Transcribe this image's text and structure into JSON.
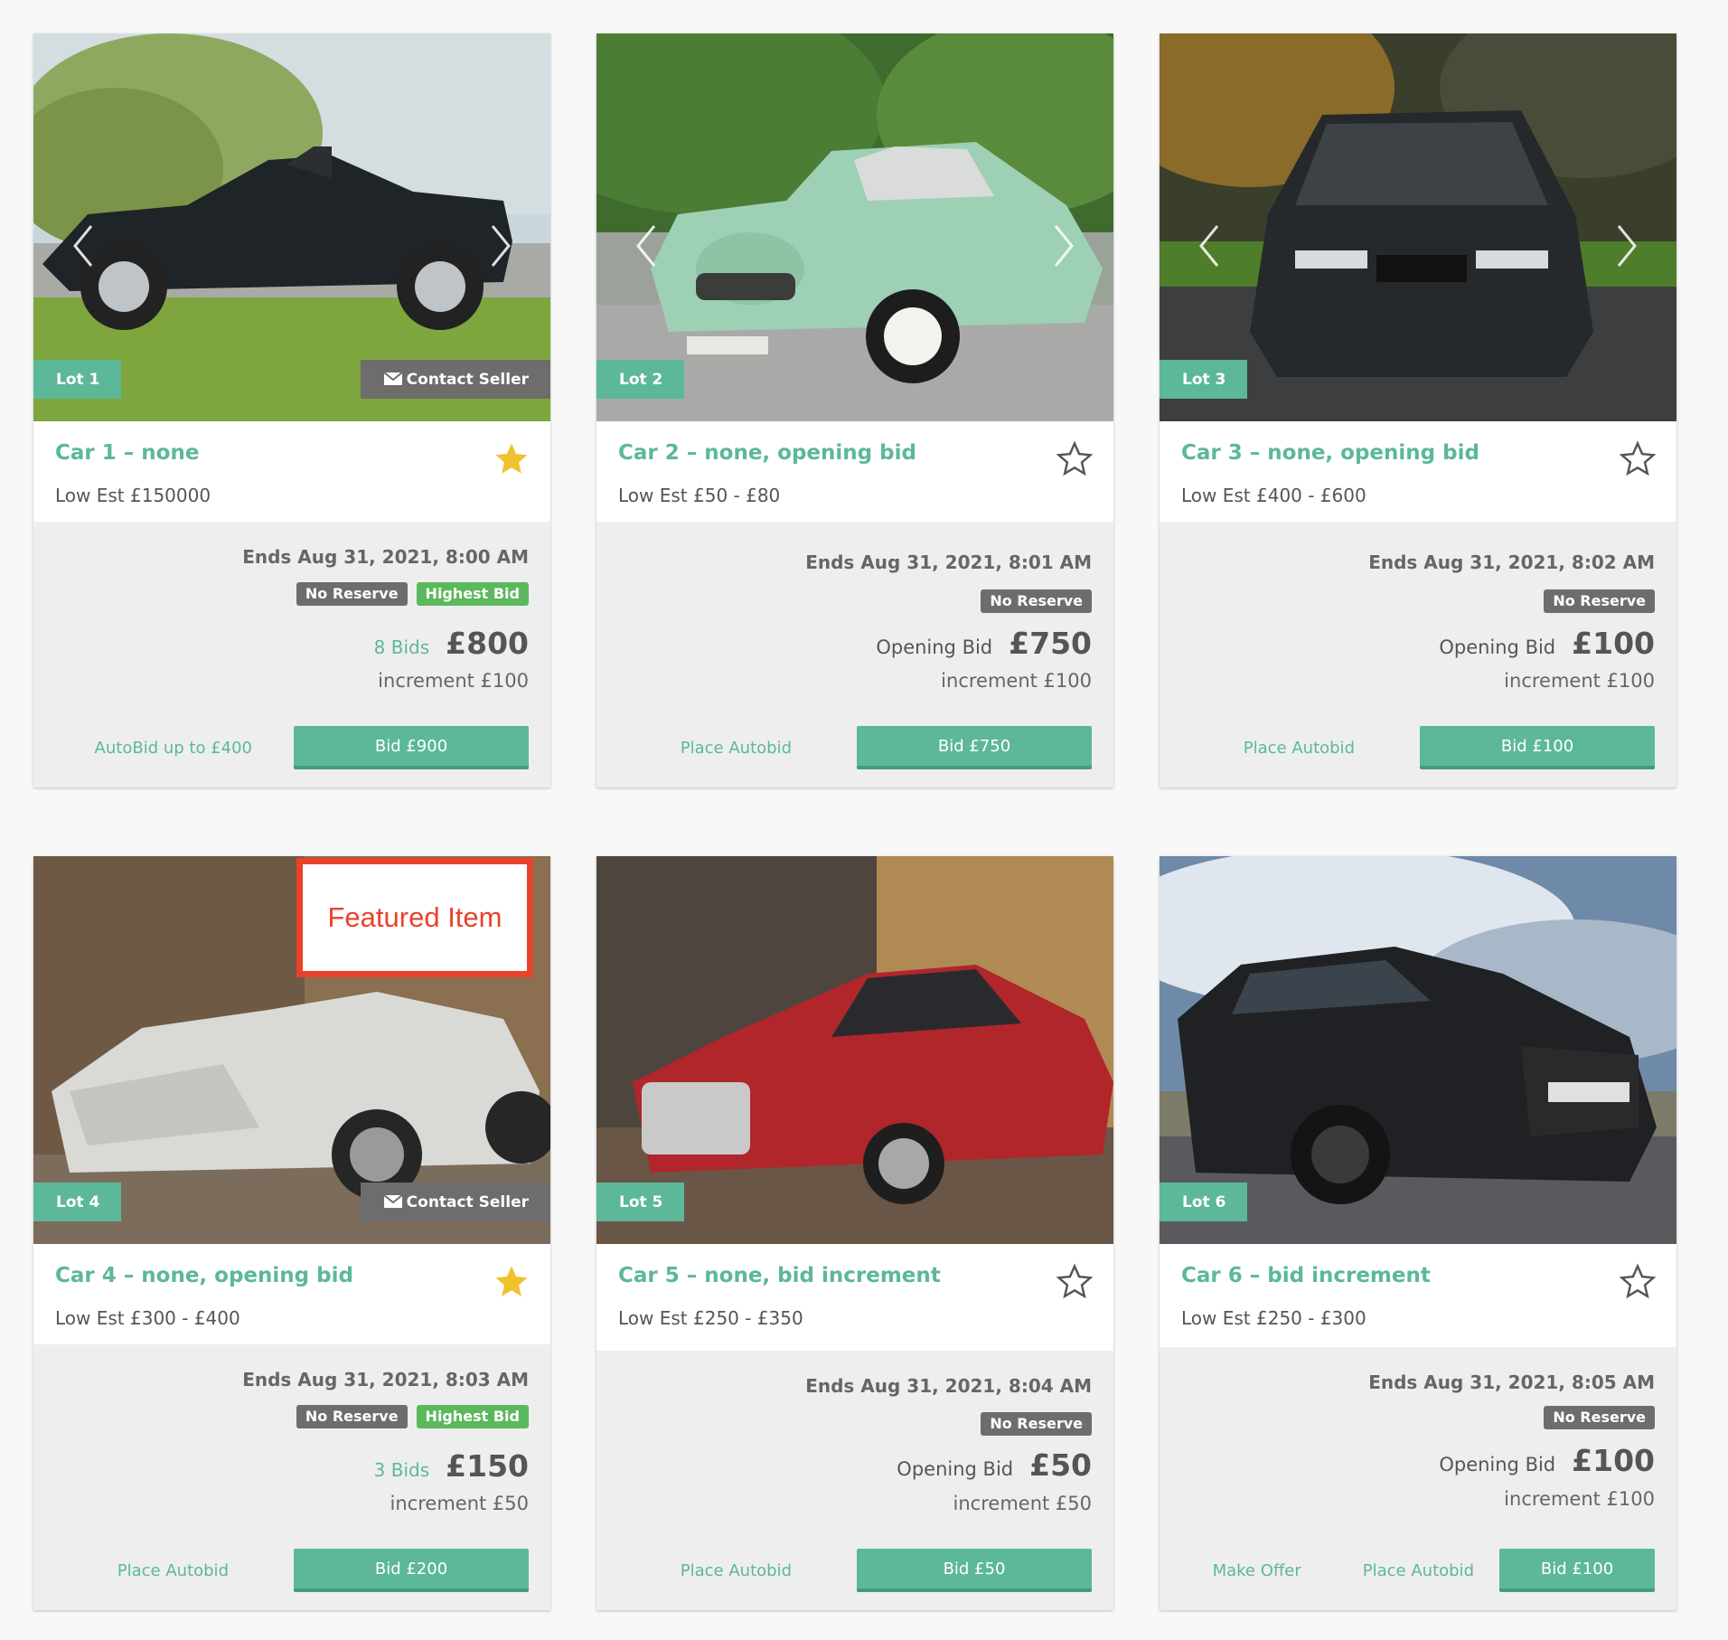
{
  "lots": [
    {
      "lot": "Lot 1",
      "title": "Car 1 – none",
      "estimate": "Low Est £150000",
      "favorite": true,
      "contact": "Contact Seller",
      "ends": "Ends Aug 31, 2021, 8:00 AM",
      "badges": [
        "No Reserve",
        "Highest Bid"
      ],
      "bids_text": "8 Bids",
      "price": "£800",
      "increment": "increment £100",
      "autobid": "AutoBid up to £400",
      "bid_button": "Bid £900"
    },
    {
      "lot": "Lot 2",
      "title": "Car 2 – none, opening bid",
      "estimate": "Low Est £50 - £80",
      "favorite": false,
      "ends": "Ends Aug 31, 2021, 8:01 AM",
      "badges": [
        "No Reserve"
      ],
      "opening_label": "Opening Bid",
      "price": "£750",
      "increment": "increment £100",
      "autobid": "Place Autobid",
      "bid_button": "Bid £750"
    },
    {
      "lot": "Lot 3",
      "title": "Car 3 – none, opening bid",
      "estimate": "Low Est £400 - £600",
      "favorite": false,
      "ends": "Ends Aug 31, 2021, 8:02 AM",
      "badges": [
        "No Reserve"
      ],
      "opening_label": "Opening Bid",
      "price": "£100",
      "increment": "increment £100",
      "autobid": "Place Autobid",
      "bid_button": "Bid £100"
    },
    {
      "lot": "Lot 4",
      "title": "Car 4 – none, opening bid",
      "estimate": "Low Est £300 - £400",
      "favorite": true,
      "contact": "Contact Seller",
      "featured": "Featured Item",
      "ends": "Ends Aug 31, 2021, 8:03 AM",
      "badges": [
        "No Reserve",
        "Highest Bid"
      ],
      "bids_text": "3 Bids",
      "price": "£150",
      "increment": "increment £50",
      "autobid": "Place Autobid",
      "bid_button": "Bid £200"
    },
    {
      "lot": "Lot 5",
      "title": "Car 5 – none, bid increment",
      "estimate": "Low Est £250 - £350",
      "favorite": false,
      "ends": "Ends Aug 31, 2021, 8:04 AM",
      "badges": [
        "No Reserve"
      ],
      "opening_label": "Opening Bid",
      "price": "£50",
      "increment": "increment £50",
      "autobid": "Place Autobid",
      "bid_button": "Bid £50"
    },
    {
      "lot": "Lot 6",
      "title": "Car 6 – bid increment",
      "estimate": "Low Est £250 - £300",
      "favorite": false,
      "ends": "Ends Aug 31, 2021, 8:05 AM",
      "badges": [
        "No Reserve"
      ],
      "opening_label": "Opening Bid",
      "price": "£100",
      "increment": "increment £100",
      "make_offer": "Make Offer",
      "autobid": "Place Autobid",
      "bid_button": "Bid £100"
    }
  ],
  "colors": {
    "accent": "#5cb898",
    "badge_grey": "#6d6d6d",
    "badge_green": "#5cb85c",
    "star_gold": "#f2c12e",
    "featured_red": "#e8422a"
  }
}
